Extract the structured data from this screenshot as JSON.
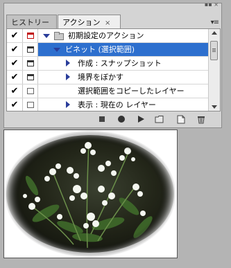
{
  "tabs": [
    {
      "label": "ヒストリー"
    },
    {
      "label": "アクション"
    }
  ],
  "tab_close_glyph": "×",
  "panel_menu_glyph": "▾≡",
  "rows": [
    {
      "label": "初期設定のアクション",
      "checked": true,
      "dialog": "red"
    },
    {
      "label": "ビネット (選択範囲)",
      "checked": true,
      "dialog": "normal",
      "selected": true
    },
    {
      "label": "作成 : スナップショット",
      "checked": true,
      "dialog": "normal"
    },
    {
      "label": "境界をぼかす",
      "checked": true,
      "dialog": "normal"
    },
    {
      "label": "選択範囲をコピーしたレイヤー",
      "checked": true,
      "dialog": "empty"
    },
    {
      "label": "表示 : 現在の レイヤー",
      "checked": true,
      "dialog": "empty"
    }
  ],
  "check_glyph": "✔",
  "toolbar": {
    "stop": "stop-icon",
    "record": "record-icon",
    "play": "play-icon",
    "new_set": "folder-icon",
    "new_action": "new-action-icon",
    "delete": "trash-icon"
  },
  "colors": {
    "selection": "#2d6fce",
    "triangle": "#2a3d9a",
    "dialog_red": "#c00000"
  }
}
